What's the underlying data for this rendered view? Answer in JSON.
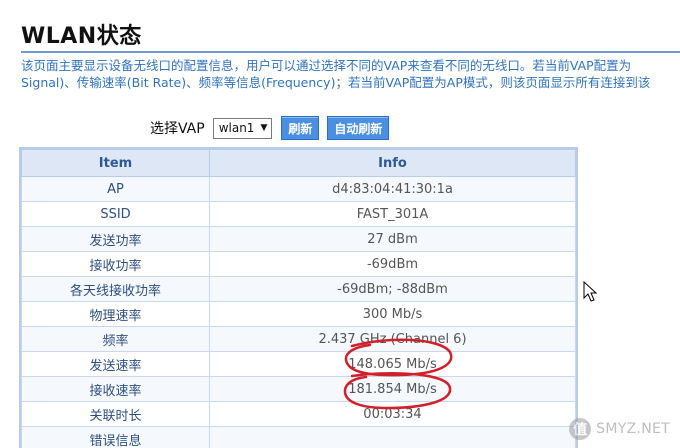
{
  "page": {
    "title": "WLAN状态",
    "description_lines": [
      "该页面主要显示设备无线口的配置信息，用户可以通过选择不同的VAP来查看不同的无线口。若当前VAP配置为",
      "Signal)、传输速率(Bit Rate)、频率等信息(Frequency)；若当前VAP配置为AP模式，则该页面显示所有连接到该"
    ]
  },
  "toolbar": {
    "vap_label": "选择VAP",
    "vap_selected": "wlan1",
    "refresh_label": "刷新",
    "auto_refresh_label": "自动刷新"
  },
  "table": {
    "headers": [
      "Item",
      "Info"
    ],
    "rows": [
      {
        "item": "AP",
        "info": "d4:83:04:41:30:1a"
      },
      {
        "item": "SSID",
        "info": "FAST_301A"
      },
      {
        "item": "发送功率",
        "info": "27 dBm"
      },
      {
        "item": "接收功率",
        "info": "-69dBm"
      },
      {
        "item": "各天线接收功率",
        "info": "-69dBm; -88dBm"
      },
      {
        "item": "物理速率",
        "info": "300 Mb/s"
      },
      {
        "item": "频率",
        "info": "2.437 GHz (Channel 6)"
      },
      {
        "item": "发送速率",
        "info": "148.065 Mb/s"
      },
      {
        "item": "接收速率",
        "info": "181.854 Mb/s"
      },
      {
        "item": "关联时长",
        "info": "00:03:34"
      },
      {
        "item": "错误信息",
        "info": ""
      }
    ]
  },
  "watermark": {
    "logo_glyph": "值",
    "text": "SMYZ.NET"
  },
  "colors": {
    "accent_button": "#4a8fe0",
    "header_bg": "#dde7f5",
    "description_text": "#3273b9",
    "annotation": "#d0202a"
  }
}
